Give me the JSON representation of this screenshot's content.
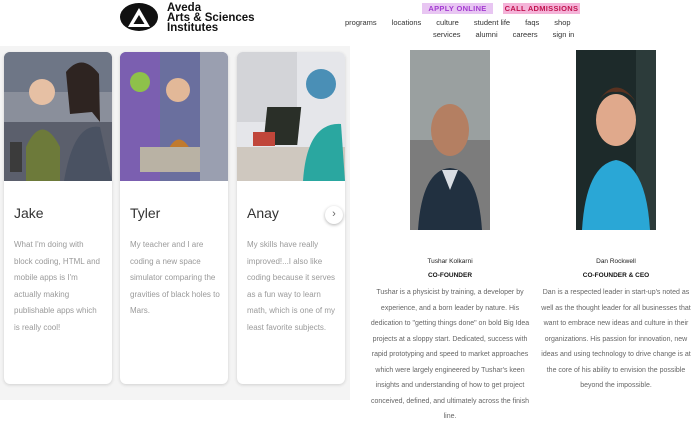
{
  "header": {
    "logo_line1": "Aveda",
    "logo_line2": "Arts & Sciences",
    "logo_line3": "Institutes",
    "apply_label": "APPLY ONLINE",
    "call_label": "CALL ADMISSIONS",
    "nav_primary": [
      "programs",
      "locations",
      "culture",
      "student life",
      "faqs",
      "shop"
    ],
    "nav_secondary": [
      "services",
      "alumni",
      "careers",
      "sign in"
    ]
  },
  "cards": [
    {
      "name": "Jake",
      "text": "What I'm doing with block coding, HTML and mobile apps is I'm actually making publishable apps which is really cool!"
    },
    {
      "name": "Tyler",
      "text": "My teacher and I are coding a new space simulator comparing the gravities of black holes to Mars."
    },
    {
      "name": "Anay",
      "text": "My skills have really improved!...I also like coding because it serves as a fun way to learn math, which is one of my least favorite subjects."
    }
  ],
  "carousel_next": "›",
  "people": [
    {
      "name": "Tushar Kolkarni",
      "title": "CO-FOUNDER",
      "bio": "Tushar is a physicist by training, a developer by experience, and a born leader by nature. His dedication to \"getting things done\" on bold Big Idea projects at a sloppy start. Dedicated, success with rapid prototyping and speed to market approaches which were largely engineered by Tushar's keen insights and understanding of how to get project conceived, defined, and ultimately across the finish line."
    },
    {
      "name": "Dan Rockwell",
      "title": "CO-FOUNDER & CEO",
      "bio": "Dan is a respected leader in start-up's noted as well as the thought leader for all businesses that want to embrace new ideas and culture in their organizations. His passion for innovation, new ideas and using technology to drive change is at the core of his ability to envision the possible beyond the impossible."
    }
  ],
  "colors": {
    "apply_bg": "#e8c6f2",
    "apply_text": "#a33bd1",
    "call_bg": "#f4b3d8",
    "call_text": "#c1124f"
  }
}
